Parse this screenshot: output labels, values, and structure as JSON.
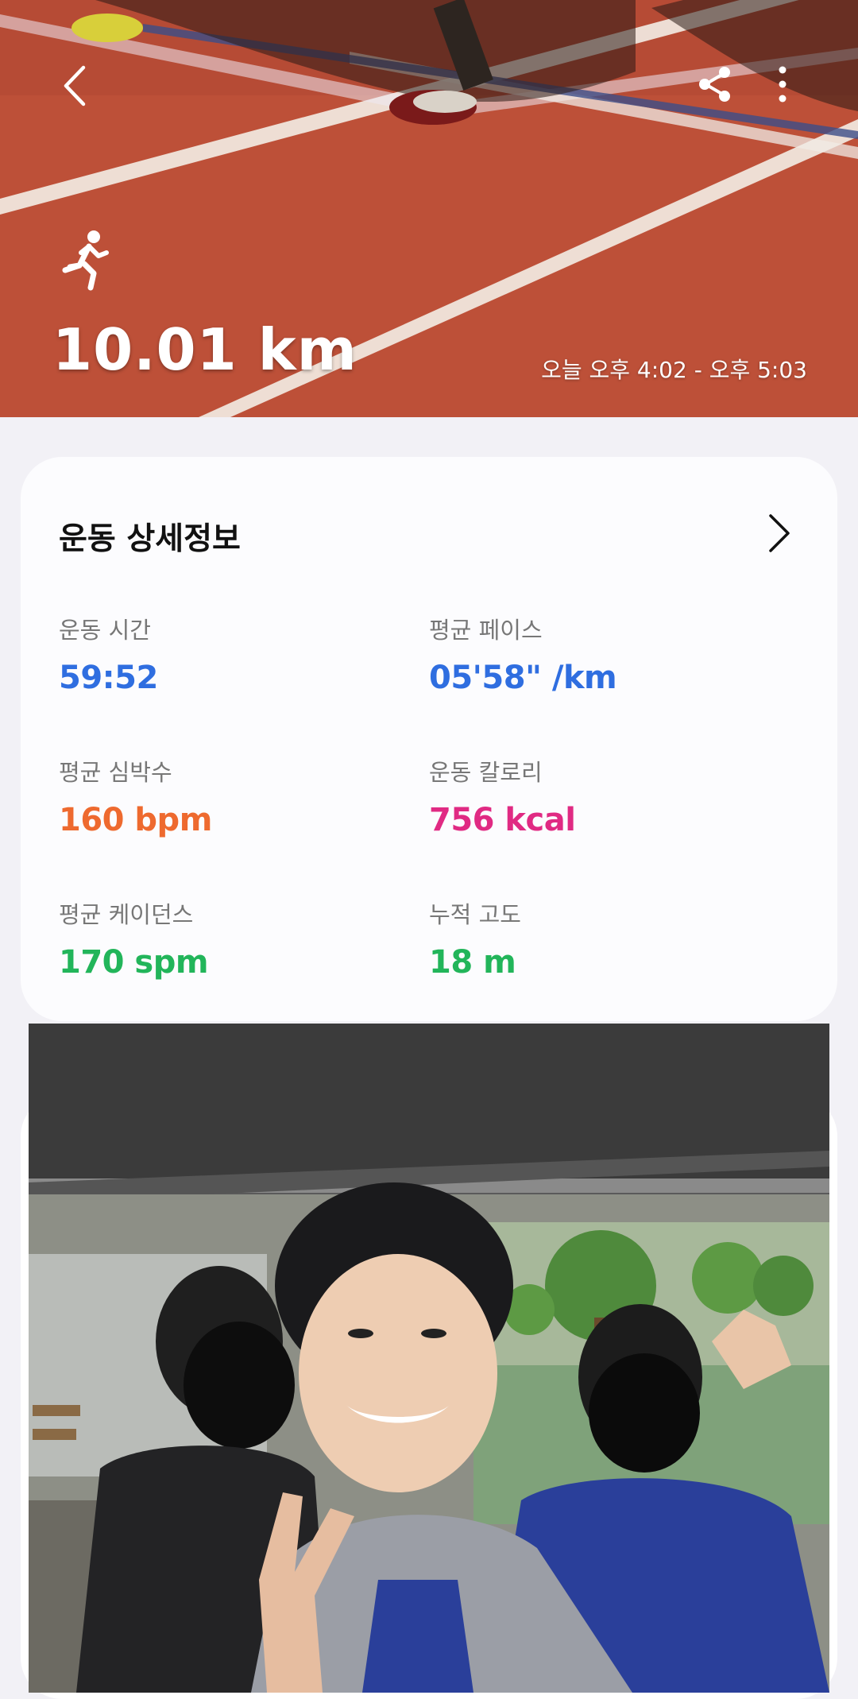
{
  "header": {
    "distance": "10.01 km",
    "time_range": "오늘 오후 4:02 - 오후 5:03",
    "icons": {
      "back": "chevron-left-icon",
      "share": "share-icon",
      "more": "more-vertical-icon",
      "activity": "running-icon"
    }
  },
  "details": {
    "title": "운동 상세정보",
    "metrics": [
      {
        "label": "운동 시간",
        "value": "59:52",
        "color": "#2f6ee0"
      },
      {
        "label": "평균 페이스",
        "value": "05'58\" /km",
        "color": "#2f6ee0"
      },
      {
        "label": "평균 심박수",
        "value": "160 bpm",
        "color": "#ee6a2f"
      },
      {
        "label": "운동 칼로리",
        "value": "756 kcal",
        "color": "#e02a83"
      },
      {
        "label": "평균 케이던스",
        "value": "170 spm",
        "color": "#22b55a"
      },
      {
        "label": "누적 고도",
        "value": "18 m",
        "color": "#22b55a"
      }
    ]
  },
  "colors": {
    "background": "#f2f1f6",
    "card": "#fcfcfe",
    "track": "#c0523a"
  }
}
